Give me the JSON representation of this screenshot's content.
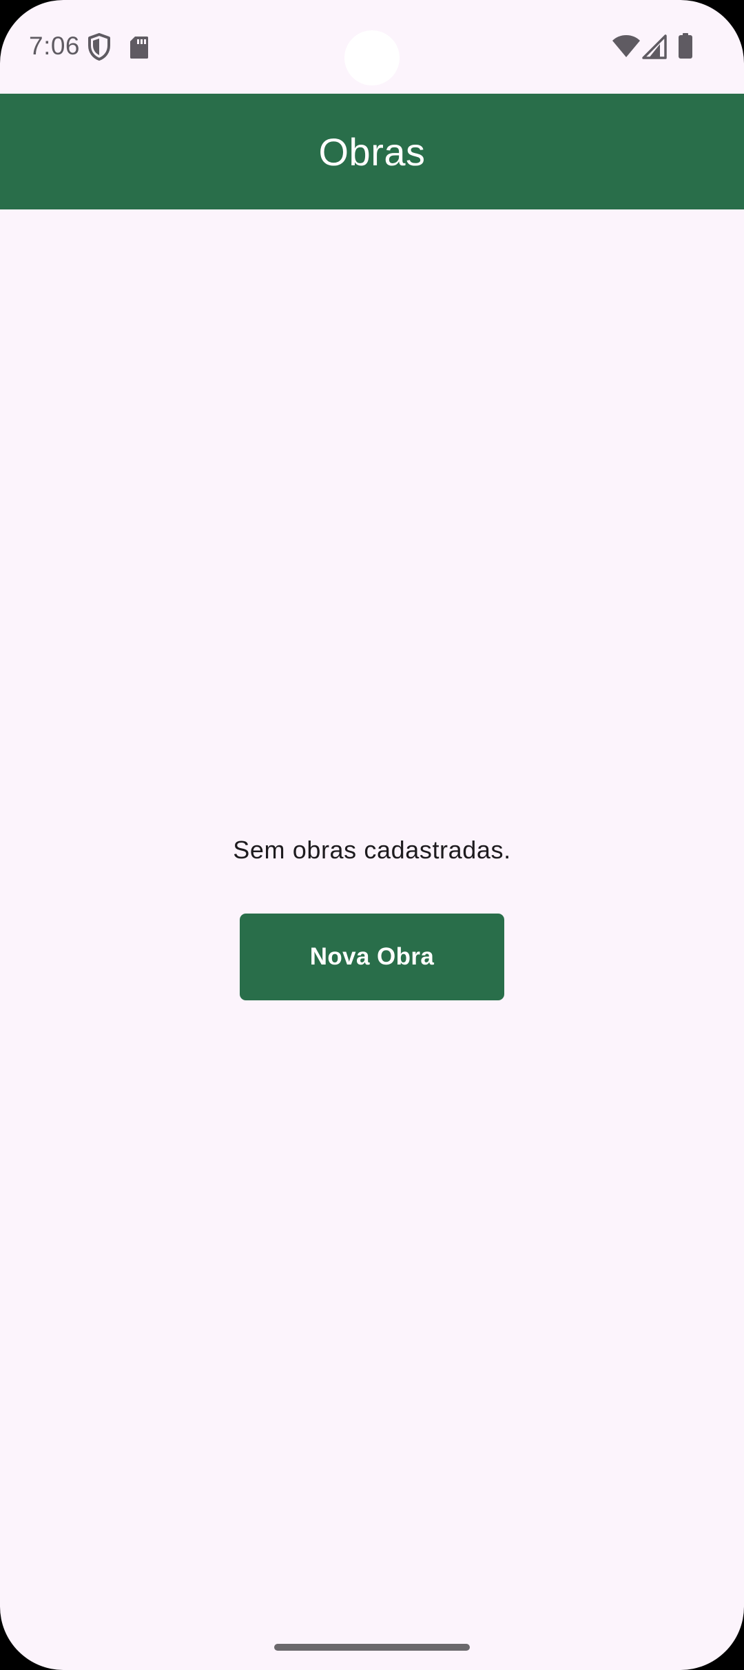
{
  "status_bar": {
    "time": "7:06",
    "left_icons": [
      "shield-icon",
      "sd-card-icon"
    ],
    "right_icons": [
      "wifi-icon",
      "cellular-signal-icon",
      "battery-icon"
    ]
  },
  "app_bar": {
    "title": "Obras"
  },
  "empty_state": {
    "message": "Sem obras cadastradas.",
    "button_label": "Nova Obra"
  },
  "colors": {
    "primary": "#296e4a",
    "background": "#fcf4fc",
    "on_primary": "#ffffff",
    "text": "#1d1b1e",
    "status_icons": "#5f5b62"
  }
}
